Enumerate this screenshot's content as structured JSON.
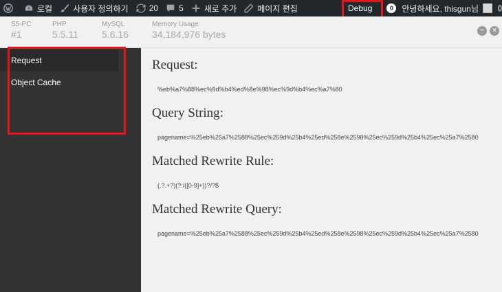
{
  "adminbar": {
    "site_name": "로컬",
    "customize": "사용자 정의하기",
    "updates_count": "20",
    "comments_count": "5",
    "new_label": "새로 추가",
    "edit_page": "페이지 편집",
    "debug_label": "Debug",
    "notif_count": "0",
    "greeting": "안녕하세요, thisgun님"
  },
  "header": {
    "stats": [
      {
        "label": "S5-PC",
        "value": "#1"
      },
      {
        "label": "PHP",
        "value": "5.5.11"
      },
      {
        "label": "MySQL",
        "value": "5.6.16"
      },
      {
        "label": "Memory Usage",
        "value": "34,184,976 bytes"
      }
    ]
  },
  "sidebar": {
    "items": [
      {
        "label": "Request"
      },
      {
        "label": "Object Cache"
      }
    ]
  },
  "content": {
    "sections": [
      {
        "title": "Request:",
        "value": "%eb%a7%88%ec%9d%b4%ed%8e%98%ec%9d%b4%ec%a7%80"
      },
      {
        "title": "Query String:",
        "value": "pagename=%25eb%25a7%2588%25ec%259d%25b4%25ed%258e%2598%25ec%259d%25b4%25ec%25a7%2580"
      },
      {
        "title": "Matched Rewrite Rule:",
        "value": "(.?.+?)(?:/([0-9]+))?/?$"
      },
      {
        "title": "Matched Rewrite Query:",
        "value": "pagename=%25eb%25a7%2588%25ec%259d%25b4%25ed%258e%2598%25ec%259d%25b4%25ec%25a7%2580"
      }
    ]
  }
}
